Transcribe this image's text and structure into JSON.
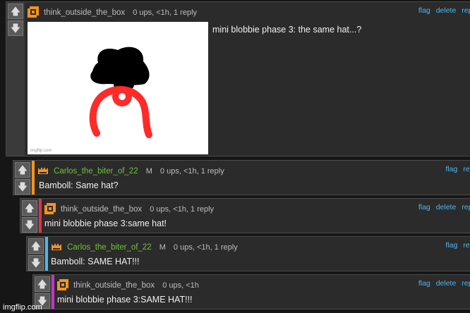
{
  "colors": {
    "orange_user": "#f7931e",
    "green_user": "#6fc23a",
    "link": "#4fb6f0"
  },
  "vote": {
    "up_icon": "arrow-up-icon",
    "down_icon": "arrow-down-icon",
    "up": "🡅",
    "down": "🡇"
  },
  "actions": {
    "flag": "flag",
    "delete": "delete",
    "reply": "reply"
  },
  "comments": [
    {
      "user": "think_outside_the_box",
      "meta": "0 ups, <1h, 1 reply",
      "text": "mini blobbie phase 3: the same hat...?",
      "image_credit": "imgflip.com"
    },
    {
      "user": "Carlos_the_biter_of_22",
      "mod": "M",
      "meta": "0 ups, <1h, 1 reply",
      "text": "Bamboll: Same hat?"
    },
    {
      "user": "think_outside_the_box",
      "meta": "0 ups, <1h, 1 reply",
      "text": "mini blobbie phase 3:same hat!"
    },
    {
      "user": "Carlos_the_biter_of_22",
      "mod": "M",
      "meta": "0 ups, <1h, 1 reply",
      "text": "Bamboll: SAME HAT!!!"
    },
    {
      "user": "think_outside_the_box",
      "meta": "0 ups, <1h",
      "text": "mini blobbie phase 3:SAME HAT!!!"
    }
  ],
  "watermark": "imgflip.com"
}
